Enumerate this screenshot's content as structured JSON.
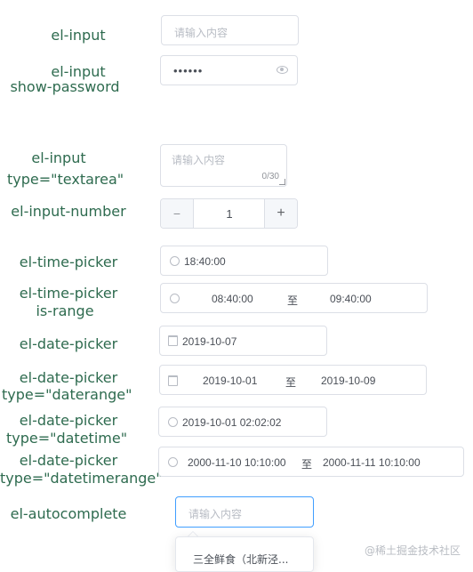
{
  "rows": {
    "input": {
      "label": "el-input",
      "placeholder": "请输入内容"
    },
    "password": {
      "label_line1": "el-input",
      "label_line2": "show-password",
      "value": "••••••",
      "eye_icon": "eye-icon"
    },
    "textarea": {
      "label_line1": "el-input",
      "label_line2": "type=\"textarea\"",
      "placeholder": "请输入内容",
      "counter": "0/30"
    },
    "number": {
      "label": "el-input-number",
      "minus": "−",
      "value": "1",
      "plus": "+"
    },
    "time_picker": {
      "label": "el-time-picker",
      "value": "18:40:00",
      "icon": "clock-icon"
    },
    "time_range": {
      "label_line1": "el-time-picker",
      "label_line2": "is-range",
      "start": "08:40:00",
      "separator": "至",
      "end": "09:40:00"
    },
    "date_picker": {
      "label": "el-date-picker",
      "value": "2019-10-07",
      "icon": "calendar-icon"
    },
    "date_range": {
      "label_line1": "el-date-picker",
      "label_line2": "type=\"daterange\"",
      "start": "2019-10-01",
      "separator": "至",
      "end": "2019-10-09"
    },
    "datetime": {
      "label_line1": "el-date-picker",
      "label_line2": "type=\"datetime\"",
      "value": "2019-10-01 02:02:02"
    },
    "datetime_range": {
      "label_line1": "el-date-picker",
      "label_line2": "type=\"datetimerange\"",
      "start": "2000-11-10 10:10:00",
      "separator": "至",
      "end": "2000-11-11 10:10:00"
    },
    "autocomplete": {
      "label": "el-autocomplete",
      "placeholder": "请输入内容",
      "suggestion": "三全鲜食（北新泾..."
    }
  },
  "watermark": "@稀土掘金技术社区",
  "colors": {
    "label": "#2e6b4f",
    "border": "#dcdfe6",
    "focus": "#409eff",
    "placeholder": "#b8bcc4"
  }
}
